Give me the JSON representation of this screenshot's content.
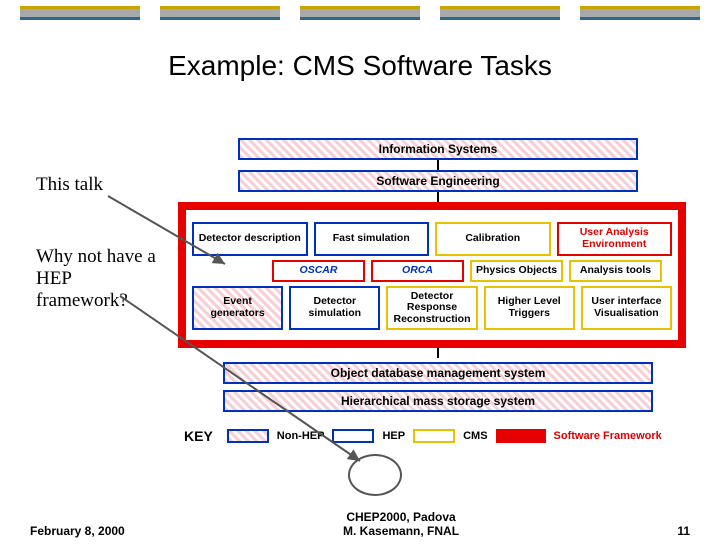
{
  "title": "Example: CMS  Software Tasks",
  "left": {
    "this_talk": "This talk",
    "why_not": "Why not have a HEP framework?"
  },
  "top_boxes": {
    "info_sys": "Information Systems",
    "sw_eng": "Software Engineering"
  },
  "red_frame": {
    "row1": {
      "det_desc": "Detector description",
      "fast_sim": "Fast simulation",
      "calibration": "Calibration",
      "ua_env": "User Analysis Environment"
    },
    "row2": {
      "oscar": "OSCAR",
      "orca": "ORCA",
      "phys_obj": "Physics Objects",
      "analysis_tools": "Analysis tools"
    },
    "row3": {
      "evt_gen": "Event generators",
      "det_sim": "Detector simulation",
      "det_resp": "Detector Response Reconstruction",
      "hlt": "Higher Level Triggers",
      "ui_vis": "User interface Visualisation"
    }
  },
  "bottom_boxes": {
    "odbms": "Object database management system",
    "hmss": "Hierarchical mass storage system"
  },
  "key": {
    "label": "KEY",
    "nonhep": "Non-HEP",
    "hep": "HEP",
    "cms": "CMS",
    "fw": "Software Framework"
  },
  "footer": {
    "date": "February 8, 2000",
    "venue": "CHEP2000, Padova",
    "author": "M. Kasemann, FNAL",
    "page": "11"
  }
}
